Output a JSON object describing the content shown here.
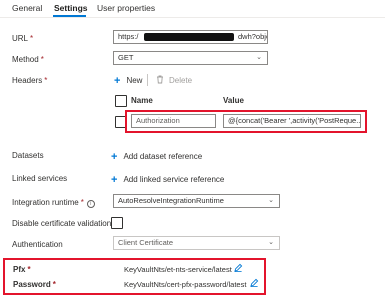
{
  "tabs": [
    {
      "label": "General"
    },
    {
      "label": "Settings"
    },
    {
      "label": "User properties"
    }
  ],
  "url": {
    "label": "URL",
    "value_prefix": "https:/",
    "value_suffix": "dwh?objec"
  },
  "method": {
    "label": "Method",
    "value": "GET"
  },
  "headers": {
    "label": "Headers",
    "new_label": "New",
    "delete_label": "Delete",
    "col_name": "Name",
    "col_value": "Value",
    "row_name": "Authorization",
    "row_value": "@{concat('Bearer ',activity('PostReque..."
  },
  "datasets": {
    "label": "Datasets",
    "action": "Add dataset reference"
  },
  "linked_services": {
    "label": "Linked services",
    "action": "Add linked service reference"
  },
  "integration_runtime": {
    "label": "Integration runtime",
    "value": "AutoResolveIntegrationRuntime"
  },
  "disable_cert": {
    "label": "Disable certificate validation"
  },
  "authentication": {
    "label": "Authentication",
    "value": "Client Certificate"
  },
  "pfx": {
    "label": "Pfx",
    "value": "KeyVaultNts/et-nts-service/latest"
  },
  "password": {
    "label": "Password",
    "value": "KeyVaultNts/cert-pfx-password/latest"
  },
  "required_mark": "*",
  "colors": {
    "accent": "#0078d4",
    "highlight": "#e3142c",
    "required": "#a4262c"
  }
}
